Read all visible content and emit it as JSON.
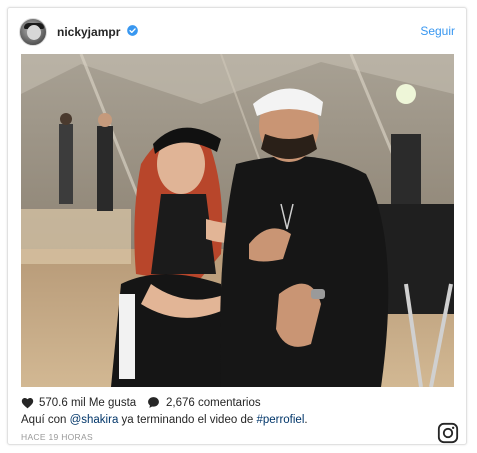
{
  "post": {
    "username": "nickyjampr",
    "verified": true,
    "follow_label": "Seguir",
    "likes_text": "570.6 mil Me gusta",
    "comments_text": "2,676 comentarios",
    "caption": {
      "prefix": "Aquí con ",
      "mention": "@shakira",
      "middle": " ya terminando el video de ",
      "hashtag": "#perrofiel",
      "suffix": "."
    },
    "timestamp": "HACE 19 HORAS"
  },
  "icons": {
    "verified": "verified-badge-icon",
    "like": "heart-icon",
    "comment": "speech-bubble-icon",
    "brand": "instagram-logo-icon"
  },
  "colors": {
    "link": "#3897f0",
    "text": "#262626",
    "muted": "#999999",
    "hashtag": "#003569"
  }
}
